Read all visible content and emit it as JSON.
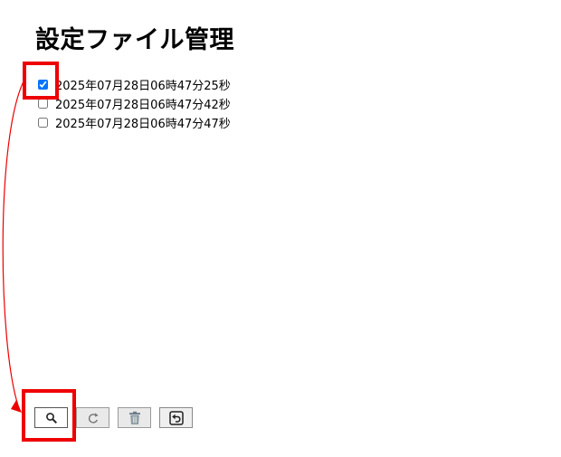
{
  "page": {
    "title": "設定ファイル管理"
  },
  "files": [
    {
      "label": "2025年07月28日06時47分25秒",
      "checked": true
    },
    {
      "label": "2025年07月28日06時47分42秒",
      "checked": false
    },
    {
      "label": "2025年07月28日06時47分47秒",
      "checked": false
    }
  ],
  "toolbar": {
    "buttons": [
      {
        "icon": "search-icon",
        "enabled": true
      },
      {
        "icon": "restore-icon",
        "enabled": false
      },
      {
        "icon": "trash-icon",
        "enabled": false
      },
      {
        "icon": "return-icon",
        "enabled": true
      }
    ]
  },
  "annotation": {
    "color": "#ee0000"
  }
}
